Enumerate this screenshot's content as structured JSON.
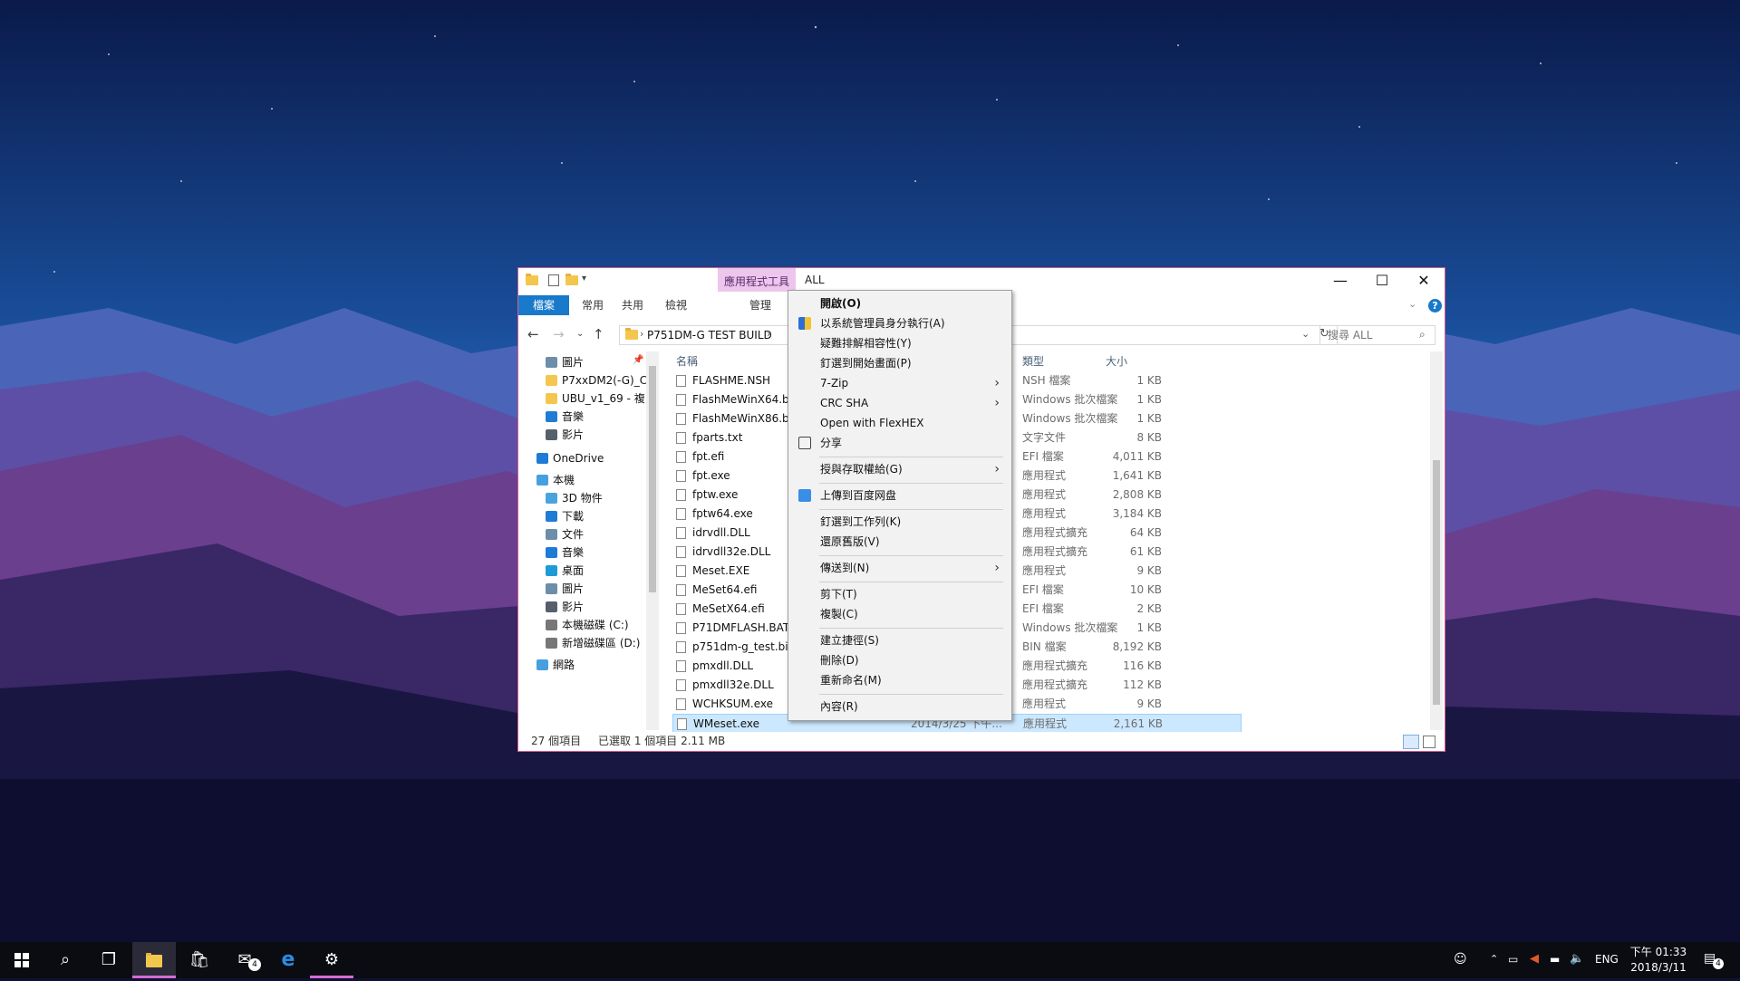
{
  "window": {
    "title": "ALL",
    "context_tab": "應用程式工具",
    "ribbon_tabs": [
      "檔案",
      "常用",
      "共用",
      "檢視",
      "管理"
    ],
    "caption": {
      "minimize": "—",
      "maximize": "☐",
      "close": "✕"
    },
    "breadcrumb": "P751DM-G TEST BUILD",
    "search_placeholder": "搜尋 ALL"
  },
  "nav": [
    {
      "label": "圖片",
      "icon": "pictures-icon"
    },
    {
      "label": "P7xxDM2(-G)_C",
      "icon": "folder-icon"
    },
    {
      "label": "UBU_v1_69 - 複",
      "icon": "folder-icon"
    },
    {
      "label": "音樂",
      "icon": "music-icon"
    },
    {
      "label": "影片",
      "icon": "videos-icon"
    },
    {
      "label": "OneDrive",
      "icon": "onedrive-icon"
    },
    {
      "label": "本機",
      "icon": "this-pc-icon"
    },
    {
      "label": "3D 物件",
      "icon": "3d-objects-icon"
    },
    {
      "label": "下載",
      "icon": "downloads-icon"
    },
    {
      "label": "文件",
      "icon": "documents-icon"
    },
    {
      "label": "音樂",
      "icon": "music-icon"
    },
    {
      "label": "桌面",
      "icon": "desktop-icon"
    },
    {
      "label": "圖片",
      "icon": "pictures-icon"
    },
    {
      "label": "影片",
      "icon": "videos-icon"
    },
    {
      "label": "本機磁碟 (C:)",
      "icon": "drive-icon"
    },
    {
      "label": "新增磁碟區 (D:)",
      "icon": "drive-icon"
    },
    {
      "label": "網路",
      "icon": "network-icon"
    }
  ],
  "columns": {
    "name": "名稱",
    "type": "類型",
    "size": "大小"
  },
  "files": [
    {
      "name": "FLASHME.NSH",
      "type": "NSH 檔案",
      "size": "1 KB"
    },
    {
      "name": "FlashMeWinX64.bat",
      "type": "Windows 批次檔案",
      "size": "1 KB"
    },
    {
      "name": "FlashMeWinX86.bat",
      "type": "Windows 批次檔案",
      "size": "1 KB"
    },
    {
      "name": "fparts.txt",
      "type": "文字文件",
      "size": "8 KB"
    },
    {
      "name": "fpt.efi",
      "type": "EFI 檔案",
      "size": "4,011 KB"
    },
    {
      "name": "fpt.exe",
      "type": "應用程式",
      "size": "1,641 KB"
    },
    {
      "name": "fptw.exe",
      "type": "應用程式",
      "size": "2,808 KB"
    },
    {
      "name": "fptw64.exe",
      "type": "應用程式",
      "size": "3,184 KB"
    },
    {
      "name": "idrvdll.DLL",
      "type": "應用程式擴充",
      "size": "64 KB"
    },
    {
      "name": "idrvdll32e.DLL",
      "type": "應用程式擴充",
      "size": "61 KB"
    },
    {
      "name": "Meset.EXE",
      "type": "應用程式",
      "size": "9 KB"
    },
    {
      "name": "MeSet64.efi",
      "type": "EFI 檔案",
      "size": "10 KB"
    },
    {
      "name": "MeSetX64.efi",
      "type": "EFI 檔案",
      "size": "2 KB"
    },
    {
      "name": "P71DMFLASH.BAT",
      "type": "Windows 批次檔案",
      "size": "1 KB"
    },
    {
      "name": "p751dm-g_test.bin",
      "type": "BIN 檔案",
      "size": "8,192 KB"
    },
    {
      "name": "pmxdll.DLL",
      "type": "應用程式擴充",
      "size": "116 KB"
    },
    {
      "name": "pmxdll32e.DLL",
      "type": "應用程式擴充",
      "size": "112 KB"
    },
    {
      "name": "WCHKSUM.exe",
      "type": "應用程式",
      "size": "9 KB"
    },
    {
      "name": "WMeset.exe",
      "type": "應用程式",
      "size": "2,161 KB",
      "date": "2014/3/25 下午..."
    }
  ],
  "status": {
    "count": "27 個項目",
    "selected": "已選取 1 個項目  2.11 MB"
  },
  "menu": {
    "items": [
      {
        "label": "開啟(O)",
        "bold": true
      },
      {
        "label": "以系統管理員身分執行(A)",
        "icon": "uac-shield-icon"
      },
      {
        "label": "疑難排解相容性(Y)"
      },
      {
        "label": "釘選到開始畫面(P)"
      },
      {
        "label": "7-Zip",
        "sub": true
      },
      {
        "label": "CRC SHA",
        "sub": true
      },
      {
        "label": "Open with FlexHEX"
      },
      {
        "label": "分享",
        "icon": "share-icon"
      },
      {
        "sep": true
      },
      {
        "label": "授與存取權給(G)",
        "sub": true
      },
      {
        "sep": true
      },
      {
        "label": "上傳到百度网盘",
        "icon": "baidu-cloud-icon"
      },
      {
        "sep": true
      },
      {
        "label": "釘選到工作列(K)"
      },
      {
        "label": "還原舊版(V)"
      },
      {
        "sep": true
      },
      {
        "label": "傳送到(N)",
        "sub": true
      },
      {
        "sep": true
      },
      {
        "label": "剪下(T)"
      },
      {
        "label": "複製(C)"
      },
      {
        "sep": true
      },
      {
        "label": "建立捷徑(S)"
      },
      {
        "label": "刪除(D)"
      },
      {
        "label": "重新命名(M)"
      },
      {
        "sep": true
      },
      {
        "label": "內容(R)"
      }
    ]
  },
  "taskbar": {
    "mail_badge": "4",
    "lang": "ENG",
    "time": "下午 01:33",
    "date": "2018/3/11",
    "notify_count": "4"
  },
  "colors": {
    "accent": "#1979ca",
    "selection": "#cce8ff",
    "context_tab": "#ecc6ec",
    "border": "#d85b8c"
  }
}
